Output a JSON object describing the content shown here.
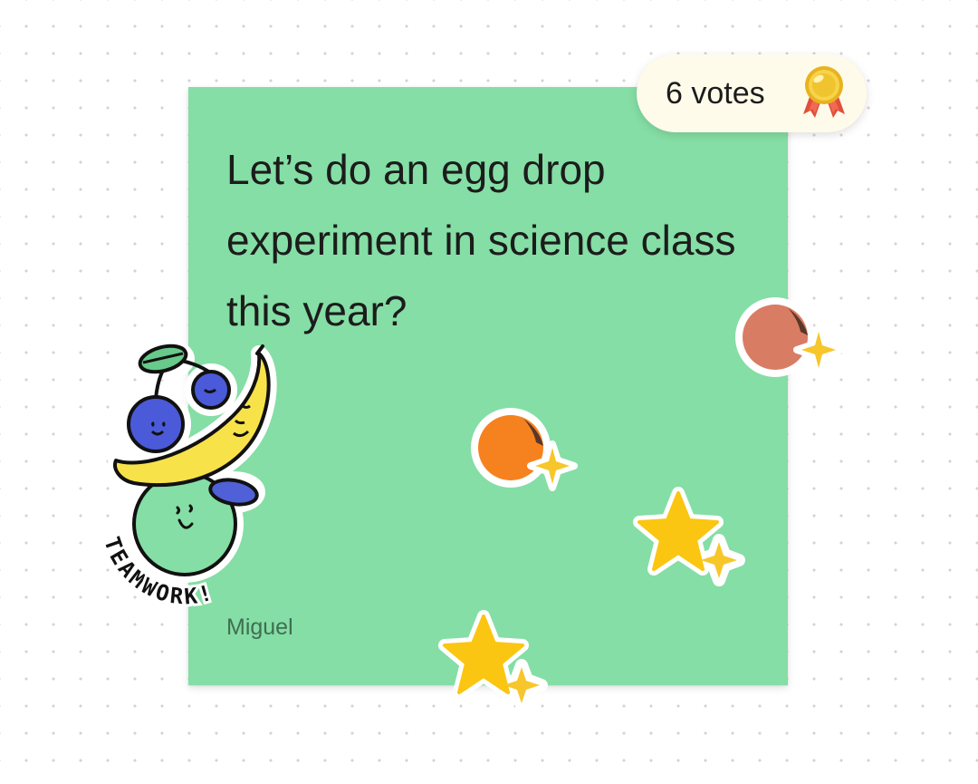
{
  "note": {
    "text": "Let’s do an egg drop experiment in science class this year?",
    "author": "Miguel",
    "color": "#85dea5"
  },
  "votes": {
    "label": "6 votes",
    "count": 6,
    "icon": "medal-icon"
  },
  "stickers": [
    {
      "name": "teamwork-fruit-sticker",
      "text": "TEAMWORK!"
    },
    {
      "name": "peel-dot-sticker-salmon",
      "color": "#d97c64"
    },
    {
      "name": "peel-dot-sticker-orange",
      "color": "#f5821f"
    },
    {
      "name": "star-sticker",
      "color": "#fbc612"
    },
    {
      "name": "star-sticker",
      "color": "#fbc612"
    }
  ]
}
